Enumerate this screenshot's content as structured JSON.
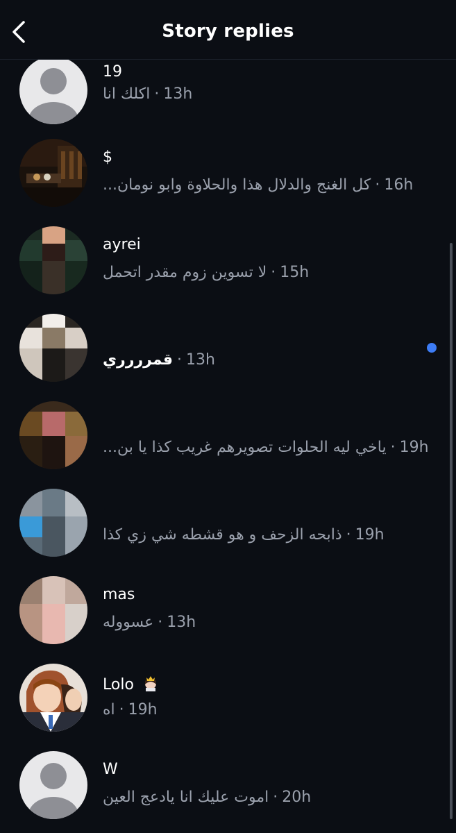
{
  "header": {
    "title": "Story replies",
    "back_icon": "chevron-left-icon"
  },
  "rows": [
    {
      "name": "19",
      "message": "اكلك انا",
      "time": "13h",
      "avatar": "default-avatar"
    },
    {
      "name": "$",
      "message": "كل الغنج والدلال هذا والحلاوة وابو نومان...",
      "time": "16h",
      "avatar": "photo-avatar-dark-room"
    },
    {
      "name": "ayrei",
      "message": "لا تسوين زوم مقدر اتحمل",
      "time": "15h",
      "avatar": "pixelated-avatar"
    },
    {
      "name": "",
      "message": "قمرررري",
      "time": "13h",
      "avatar": "pixelated-avatar",
      "unread": true
    },
    {
      "name": "",
      "message": "ياخي ليه الحلوات تصويرهم غريب كذا يا بن...",
      "time": "19h",
      "avatar": "pixelated-avatar"
    },
    {
      "name": "",
      "message": "ذابحه الزحف و هو قشطه شي زي كذا",
      "time": "19h",
      "avatar": "pixelated-avatar"
    },
    {
      "name": "mas",
      "message": "عسووله",
      "time": "13h",
      "avatar": "pixelated-avatar"
    },
    {
      "name": "Lolo",
      "name_emoji": "princess-crown-icon",
      "message": "اه",
      "time": "19h",
      "avatar": "anime-avatar"
    },
    {
      "name": "W",
      "message": "اموت عليك انا يادعج العين",
      "time": "20h",
      "avatar": "default-avatar"
    }
  ],
  "colors": {
    "background": "#0b0e14",
    "secondary_text": "#9aa0ac",
    "unread_dot": "#3d7cf5"
  }
}
